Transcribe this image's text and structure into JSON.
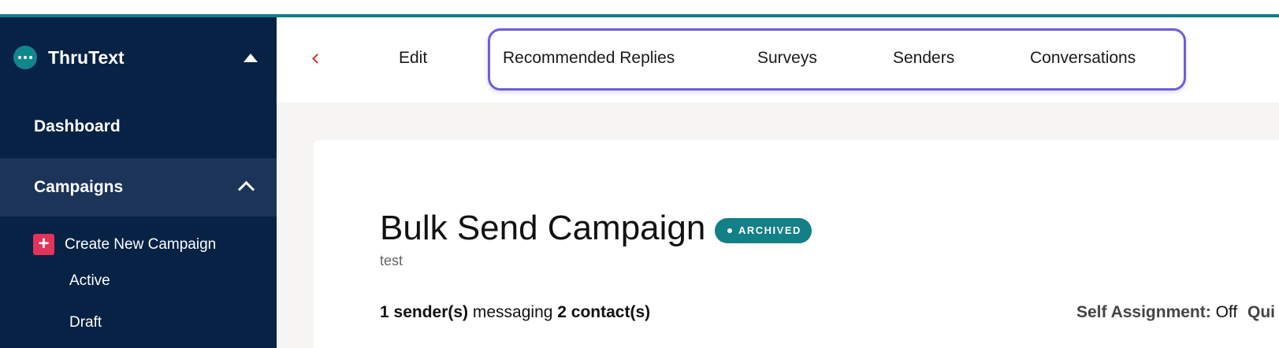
{
  "app": {
    "name": "ThruText",
    "accent_color": "#0f7f86",
    "sidebar_bg": "#062244"
  },
  "sidebar": {
    "logo_icon": "thrutext-logo-dots",
    "collapse_icon": "caret-up-icon",
    "items": [
      {
        "label": "Dashboard"
      },
      {
        "label": "Campaigns",
        "expanded": true,
        "icon": "chevron-up-icon"
      },
      {
        "label": "Create New Campaign",
        "icon": "plus-icon"
      },
      {
        "label": "Active"
      },
      {
        "label": "Draft"
      }
    ]
  },
  "tabs": {
    "back_icon": "chevron-left-icon",
    "items": [
      {
        "label": "Edit"
      },
      {
        "label": "Recommended Replies"
      },
      {
        "label": "Surveys"
      },
      {
        "label": "Senders"
      },
      {
        "label": "Conversations"
      }
    ],
    "highlight_color": "#6c5fd6"
  },
  "campaign": {
    "title": "Bulk Send Campaign",
    "status_badge": "ARCHIVED",
    "description": "test",
    "senders_count": "1 sender(s)",
    "messaging_text": " messaging ",
    "contacts_count": "2 contact(s)",
    "self_assignment_label": "Self Assignment:",
    "self_assignment_value": " Off",
    "truncated_label": "Qui"
  }
}
